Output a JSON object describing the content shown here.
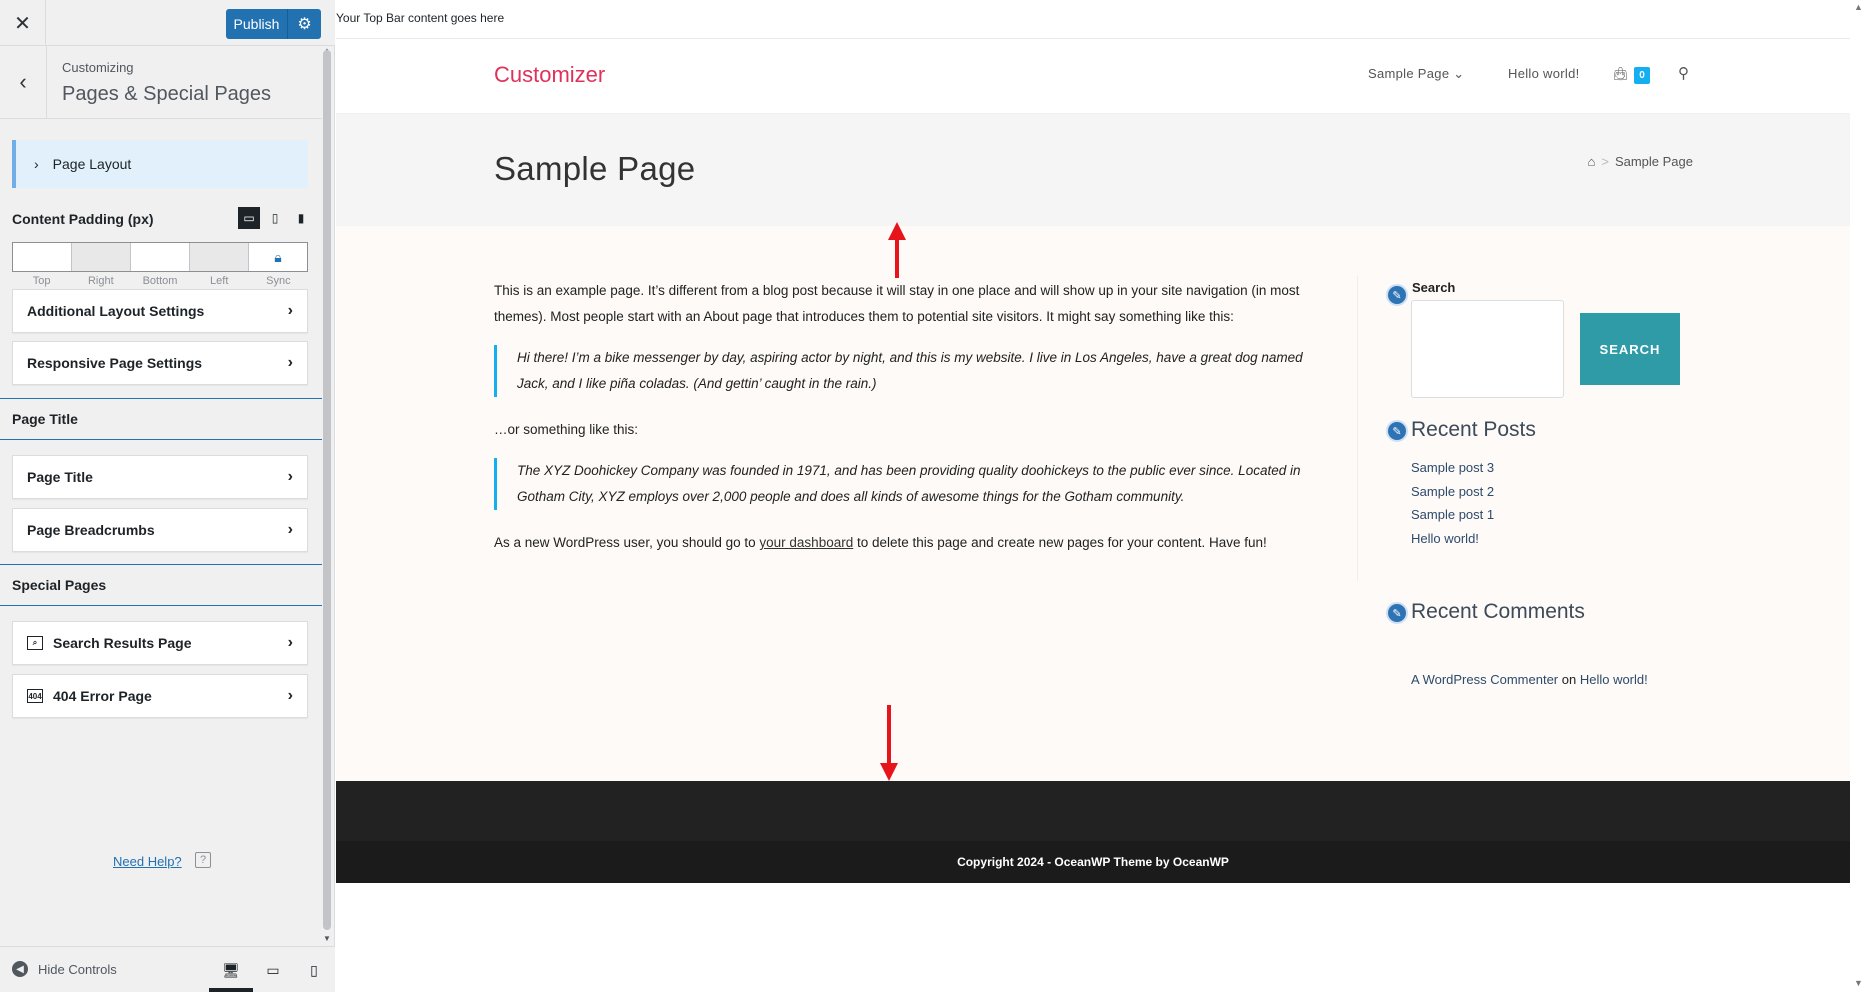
{
  "customizer": {
    "publish_label": "Publish",
    "customizing_label": "Customizing",
    "section_title": "Pages & Special Pages",
    "page_layout_label": "Page Layout",
    "content_padding": {
      "label": "Content Padding (px)",
      "fields": [
        "Top",
        "Right",
        "Bottom",
        "Left",
        "Sync"
      ]
    },
    "rows": {
      "additional_layout": "Additional Layout Settings",
      "responsive_page": "Responsive Page Settings",
      "page_title_row": "Page Title",
      "page_breadcrumbs": "Page Breadcrumbs",
      "search_results": "Search Results Page",
      "error_404": "404 Error Page"
    },
    "groups": {
      "page_title": "Page Title",
      "special_pages": "Special Pages"
    },
    "need_help": "Need Help?",
    "hide_controls": "Hide Controls",
    "icon_404": "404"
  },
  "preview": {
    "topbar_text": "Your Top Bar content goes here",
    "site_title": "Customizer",
    "nav": {
      "sample_page": "Sample Page",
      "hello_world": "Hello world!",
      "cart_count": "0"
    },
    "page_title": "Sample Page",
    "breadcrumb_current": "Sample Page",
    "content": {
      "p1": "This is an example page. It’s different from a blog post because it will stay in one place and will show up in your site navigation (in most themes). Most people start with an About page that introduces them to potential site visitors. It might say something like this:",
      "quote1": "Hi there! I’m a bike messenger by day, aspiring actor by night, and this is my website. I live in Los Angeles, have a great dog named Jack, and I like piña coladas. (And gettin’ caught in the rain.)",
      "p2": "…or something like this:",
      "quote2": "The XYZ Doohickey Company was founded in 1971, and has been providing quality doohickeys to the public ever since. Located in Gotham City, XYZ employs over 2,000 people and does all kinds of awesome things for the Gotham community.",
      "p3_before": "As a new WordPress user, you should go to ",
      "p3_link": "your dashboard",
      "p3_after": " to delete this page and create new pages for your content. Have fun!"
    },
    "sidebar": {
      "search_label": "Search",
      "search_button": "SEARCH",
      "recent_posts_title": "Recent Posts",
      "recent_posts": [
        "Sample post 3",
        "Sample post 2",
        "Sample post 1",
        "Hello world!"
      ],
      "recent_comments_title": "Recent Comments",
      "comment_author": "A WordPress Commenter",
      "comment_on": " on ",
      "comment_post": "Hello world!"
    },
    "copyright": "Copyright 2024 - OceanWP Theme by OceanWP"
  },
  "colors": {
    "accent": "#2271b1",
    "site_title": "#e0315a",
    "arrow": "#e8141c",
    "footer": "#222222"
  }
}
